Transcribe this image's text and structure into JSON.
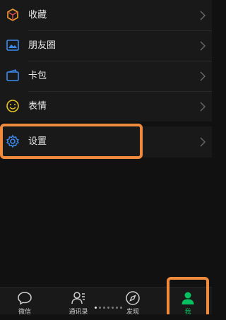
{
  "menu": {
    "items": [
      {
        "label": "收藏",
        "icon": "favorites-cube-icon"
      },
      {
        "label": "朋友圈",
        "icon": "moments-picture-icon"
      },
      {
        "label": "卡包",
        "icon": "card-wallet-icon"
      },
      {
        "label": "表情",
        "icon": "sticker-smile-icon"
      }
    ],
    "settings": {
      "label": "设置",
      "icon": "gear-icon"
    }
  },
  "tabbar": {
    "tabs": [
      {
        "label": "微信",
        "icon": "chat-bubble-icon",
        "active": false
      },
      {
        "label": "通讯录",
        "icon": "contacts-icon",
        "active": false
      },
      {
        "label": "发现",
        "icon": "compass-icon",
        "active": false
      },
      {
        "label": "我",
        "icon": "person-icon",
        "active": true
      }
    ],
    "page_indicator": {
      "count": 7,
      "current": 1
    }
  },
  "colors": {
    "background": "#111111",
    "row_background": "#191919",
    "text": "#e6e6e6",
    "accent_green": "#07c160",
    "highlight_orange": "#f08a3c"
  }
}
